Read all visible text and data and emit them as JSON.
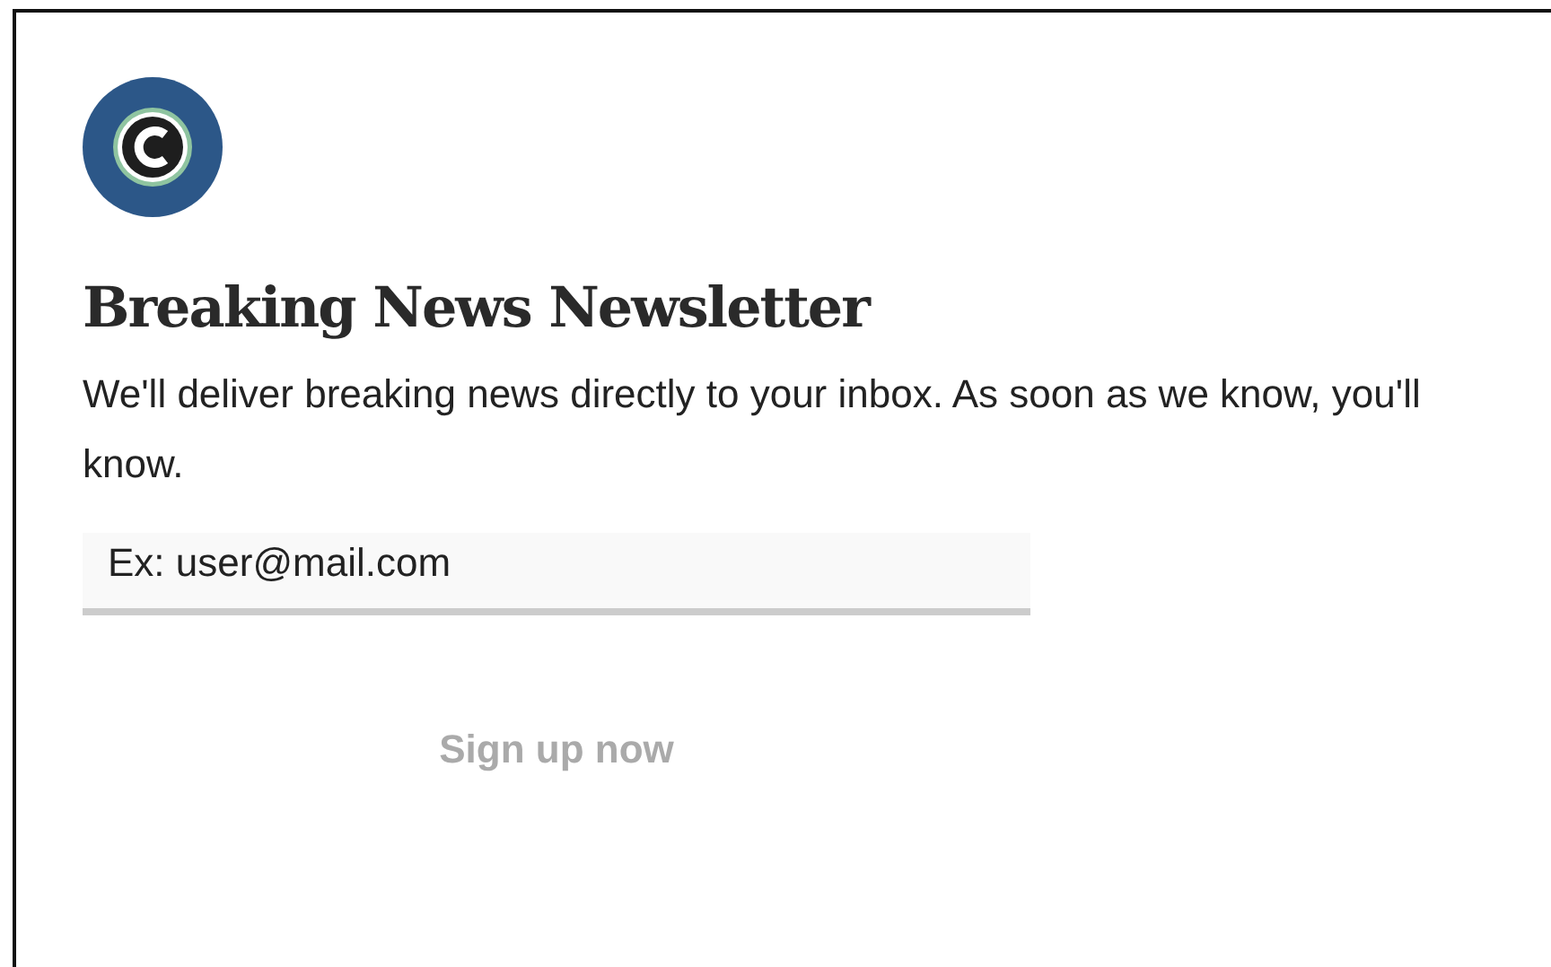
{
  "heading": "Breaking News Newsletter",
  "description": "We'll deliver breaking news directly to your inbox. As soon as we know, you'll know.",
  "email_field": {
    "placeholder": "Ex: user@mail.com"
  },
  "signup_button": {
    "label": "Sign up now",
    "disabled": true
  }
}
